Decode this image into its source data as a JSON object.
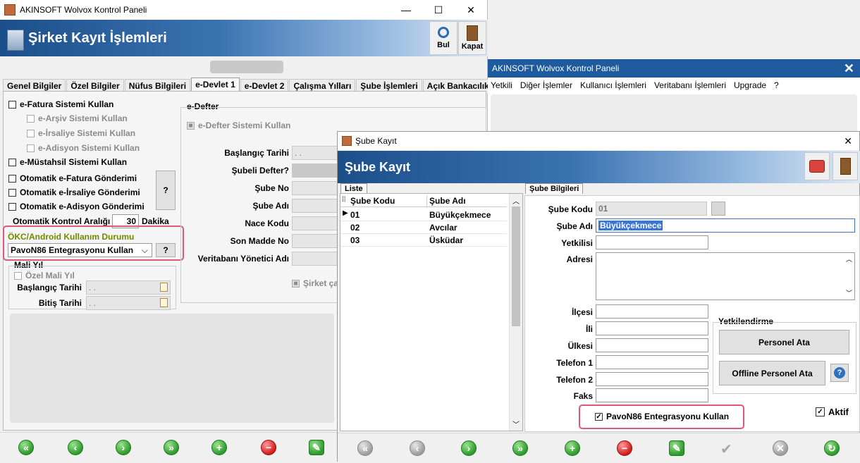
{
  "main_window": {
    "title": "AKINSOFT Wolvox Kontrol Paneli",
    "header_title": "Şirket Kayıt İşlemleri",
    "find_label": "Bul",
    "close_label": "Kapat",
    "tabs": [
      "Genel Bilgiler",
      "Özel Bilgiler",
      "Nüfus Bilgileri",
      "e-Devlet 1",
      "e-Devlet 2",
      "Çalışma Yılları",
      "Şube İşlemleri",
      "Açık Bankacılık"
    ],
    "checks": {
      "efatura": "e-Fatura Sistemi Kullan",
      "earsiv": "e-Arşiv Sistemi Kullan",
      "eirsaliye": "e-İrsaliye Sistemi Kullan",
      "eadisyon": "e-Adisyon Sistemi Kullan",
      "emustahsil": "e-Müstahsil Sistemi Kullan",
      "oto_efatura": "Otomatik e-Fatura Gönderimi",
      "oto_eirsaliye": "Otomatik e-İrsaliye Gönderimi",
      "oto_eadisyon": "Otomatik e-Adisyon Gönderimi"
    },
    "help_label": "?",
    "auto_control_label": "Otomatik Kontrol Aralığı",
    "auto_control_value": "30",
    "auto_control_unit": "Dakika",
    "okc_label": "ÖKC/Android Kullanım Durumu",
    "okc_value": "PavoN86 Entegrasyonu Kullan",
    "mali_yil": {
      "group_label": "Mali Yıl",
      "ozel_label": "Özel Mali Yıl",
      "start_label": "Başlangıç Tarihi",
      "end_label": "Bitiş Tarihi",
      "date_placeholder": ". ."
    },
    "edefter": {
      "group_label": "e-Defter",
      "use_label": "e-Defter Sistemi Kullan",
      "start_label": "Başlangıç Tarihi",
      "start_value": ". .",
      "subeli_label": "Şubeli Defter?",
      "sube_no_label": "Şube No",
      "sube_adi_label": "Şube Adı",
      "nace_label": "Nace Kodu",
      "son_madde_label": "Son Madde No",
      "vt_label": "Veritabanı Yönetici Adı",
      "sirket_label": "Şirket ça"
    }
  },
  "back_window": {
    "title": "AKINSOFT Wolvox Kontrol Paneli",
    "menu": [
      "Yetkili",
      "Diğer İşlemler",
      "Kullanıcı İşlemleri",
      "Veritabanı İşlemleri",
      "Upgrade",
      "?"
    ]
  },
  "sube_window": {
    "title": "Şube Kayıt",
    "header_title": "Şube Kayıt",
    "list_tab": "Liste",
    "columns": [
      "Şube Kodu",
      "Şube Adı"
    ],
    "rows": [
      {
        "code": "01",
        "name": "Büyükçekmece"
      },
      {
        "code": "02",
        "name": "Avcılar"
      },
      {
        "code": "03",
        "name": "Üsküdar"
      }
    ],
    "detail_tab": "Şube Bilgileri",
    "labels": {
      "kodu": "Şube Kodu",
      "adi": "Şube Adı",
      "yetkili": "Yetkilisi",
      "adres": "Adresi",
      "ilce": "İlçesi",
      "il": "İli",
      "ulke": "Ülkesi",
      "tel1": "Telefon 1",
      "tel2": "Telefon 2",
      "faks": "Faks"
    },
    "values": {
      "kodu": "01",
      "adi": "Büyükçekmece"
    },
    "yetkilendirme": {
      "group_label": "Yetkilendirme",
      "personel_ata": "Personel Ata",
      "offline_personel_ata": "Offline Personel Ata",
      "help": "?"
    },
    "pavo_label": "PavoN86 Entegrasyonu Kullan",
    "aktif_label": "Aktif"
  },
  "colors": {
    "header_dark": "#1c4f8a",
    "highlight_red": "#e05878",
    "selection_blue": "#3875d7",
    "titlebar_blue": "#1d5a9e"
  }
}
